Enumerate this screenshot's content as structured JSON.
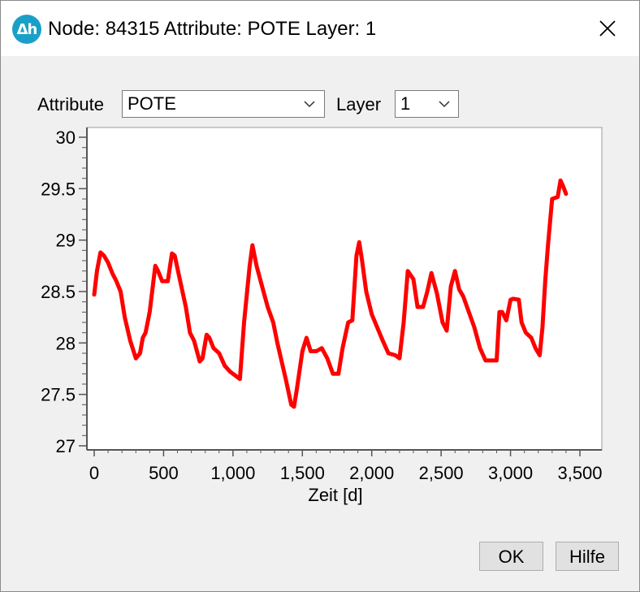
{
  "window": {
    "title": "Node: 84315 Attribute: POTE Layer: 1",
    "app_icon_text": "Δh",
    "icons": {
      "app": "app-logo-icon",
      "close": "close-icon"
    }
  },
  "toolbar": {
    "attribute_label": "Attribute",
    "attribute_value": "POTE",
    "layer_label": "Layer",
    "layer_value": "1"
  },
  "buttons": {
    "ok": "OK",
    "help": "Hilfe"
  },
  "colors": {
    "series": "#ff0000",
    "app_icon": "#1aa0c8",
    "dialog_bg": "#f0f0f0"
  },
  "chart_data": {
    "type": "line",
    "title": "",
    "xlabel": "Zeit [d]",
    "ylabel": "",
    "xlim": [
      0,
      3500
    ],
    "ylim": [
      27,
      30
    ],
    "xticks": [
      {
        "value": 0,
        "label": "0"
      },
      {
        "value": 500,
        "label": "500"
      },
      {
        "value": 1000,
        "label": "1,000"
      },
      {
        "value": 1500,
        "label": "1,500"
      },
      {
        "value": 2000,
        "label": "2,000"
      },
      {
        "value": 2500,
        "label": "2,500"
      },
      {
        "value": 3000,
        "label": "3,000"
      },
      {
        "value": 3500,
        "label": "3,500"
      }
    ],
    "yticks": [
      {
        "value": 27,
        "label": "27"
      },
      {
        "value": 27.5,
        "label": "27.5"
      },
      {
        "value": 28,
        "label": "28"
      },
      {
        "value": 28.5,
        "label": "28.5"
      },
      {
        "value": 29,
        "label": "29"
      },
      {
        "value": 29.5,
        "label": "29.5"
      },
      {
        "value": 30,
        "label": "30"
      }
    ],
    "grid": false,
    "series": [
      {
        "name": "",
        "x": [
          0,
          20,
          45,
          70,
          100,
          130,
          160,
          190,
          220,
          260,
          300,
          330,
          350,
          370,
          400,
          440,
          460,
          490,
          530,
          560,
          580,
          620,
          660,
          690,
          720,
          760,
          780,
          810,
          830,
          860,
          900,
          940,
          980,
          1020,
          1050,
          1080,
          1120,
          1140,
          1170,
          1210,
          1250,
          1290,
          1320,
          1380,
          1420,
          1440,
          1460,
          1500,
          1530,
          1560,
          1600,
          1640,
          1680,
          1720,
          1760,
          1790,
          1830,
          1860,
          1890,
          1910,
          1930,
          1960,
          2000,
          2040,
          2080,
          2120,
          2170,
          2200,
          2230,
          2260,
          2300,
          2330,
          2370,
          2400,
          2430,
          2470,
          2510,
          2540,
          2570,
          2600,
          2630,
          2660,
          2700,
          2740,
          2780,
          2820,
          2860,
          2900,
          2920,
          2940,
          2970,
          3000,
          3020,
          3060,
          3080,
          3110,
          3150,
          3180,
          3210,
          3230,
          3250,
          3270,
          3300,
          3340,
          3360,
          3380,
          3400
        ],
        "y": [
          28.47,
          28.7,
          28.88,
          28.85,
          28.78,
          28.68,
          28.6,
          28.5,
          28.25,
          28.02,
          27.85,
          27.9,
          28.05,
          28.1,
          28.3,
          28.75,
          28.7,
          28.6,
          28.6,
          28.87,
          28.85,
          28.6,
          28.35,
          28.1,
          28.02,
          27.82,
          27.85,
          28.08,
          28.05,
          27.95,
          27.9,
          27.78,
          27.72,
          27.68,
          27.65,
          28.2,
          28.75,
          28.95,
          28.75,
          28.55,
          28.35,
          28.2,
          28.0,
          27.65,
          27.4,
          27.38,
          27.55,
          27.92,
          28.05,
          27.92,
          27.92,
          27.95,
          27.85,
          27.7,
          27.7,
          27.95,
          28.2,
          28.22,
          28.85,
          28.98,
          28.8,
          28.5,
          28.28,
          28.15,
          28.02,
          27.9,
          27.88,
          27.85,
          28.2,
          28.7,
          28.62,
          28.35,
          28.35,
          28.5,
          28.68,
          28.48,
          28.2,
          28.12,
          28.55,
          28.7,
          28.52,
          28.45,
          28.3,
          28.15,
          27.95,
          27.83,
          27.83,
          27.83,
          28.3,
          28.3,
          28.22,
          28.42,
          28.43,
          28.42,
          28.2,
          28.1,
          28.05,
          27.95,
          27.88,
          28.15,
          28.6,
          28.95,
          29.4,
          29.42,
          29.58,
          29.52,
          29.45
        ]
      }
    ]
  }
}
